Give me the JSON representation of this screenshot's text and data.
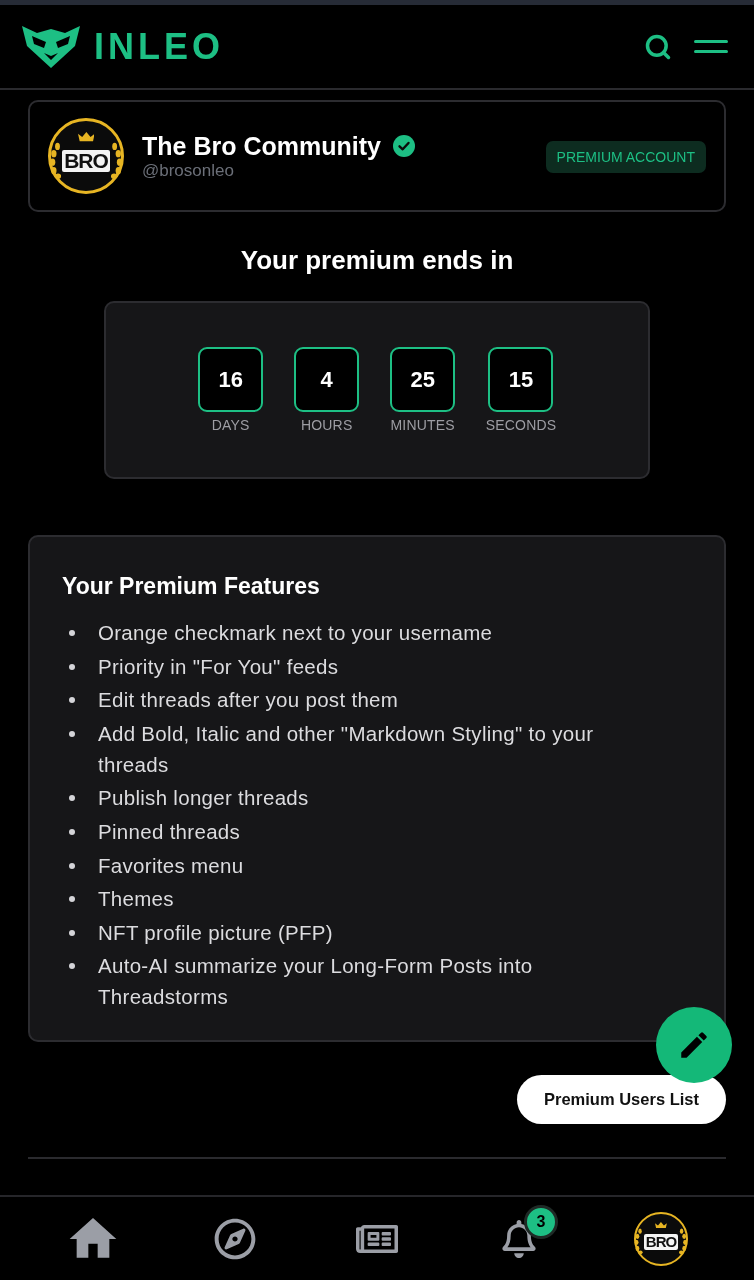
{
  "header": {
    "logo_text": "INLEO"
  },
  "profile": {
    "avatar_text": "BRO",
    "name": "The Bro Community",
    "verified": true,
    "handle": "@brosonleo",
    "badge": "PREMIUM ACCOUNT"
  },
  "countdown": {
    "title": "Your premium ends in",
    "units": [
      {
        "value": "16",
        "label": "DAYS"
      },
      {
        "value": "4",
        "label": "HOURS"
      },
      {
        "value": "25",
        "label": "MINUTES"
      },
      {
        "value": "15",
        "label": "SECONDS"
      }
    ]
  },
  "features": {
    "title": "Your Premium Features",
    "items": [
      "Orange checkmark next to your username",
      "Priority in \"For You\" feeds",
      "Edit threads after you post them",
      "Add Bold, Italic and other \"Markdown Styling\" to your threads",
      "Publish longer threads",
      "Pinned threads",
      "Favorites menu",
      "Themes",
      "NFT profile picture (PFP)",
      "Auto-AI summarize your Long-Form Posts into Threadstorms"
    ]
  },
  "premium_users_button": "Premium Users List",
  "bottom_nav": {
    "items": [
      {
        "kind": "home"
      },
      {
        "kind": "explore"
      },
      {
        "kind": "news"
      },
      {
        "kind": "notifications",
        "badge": "3"
      },
      {
        "kind": "avatar",
        "avatar_text": "BRO"
      }
    ]
  }
}
